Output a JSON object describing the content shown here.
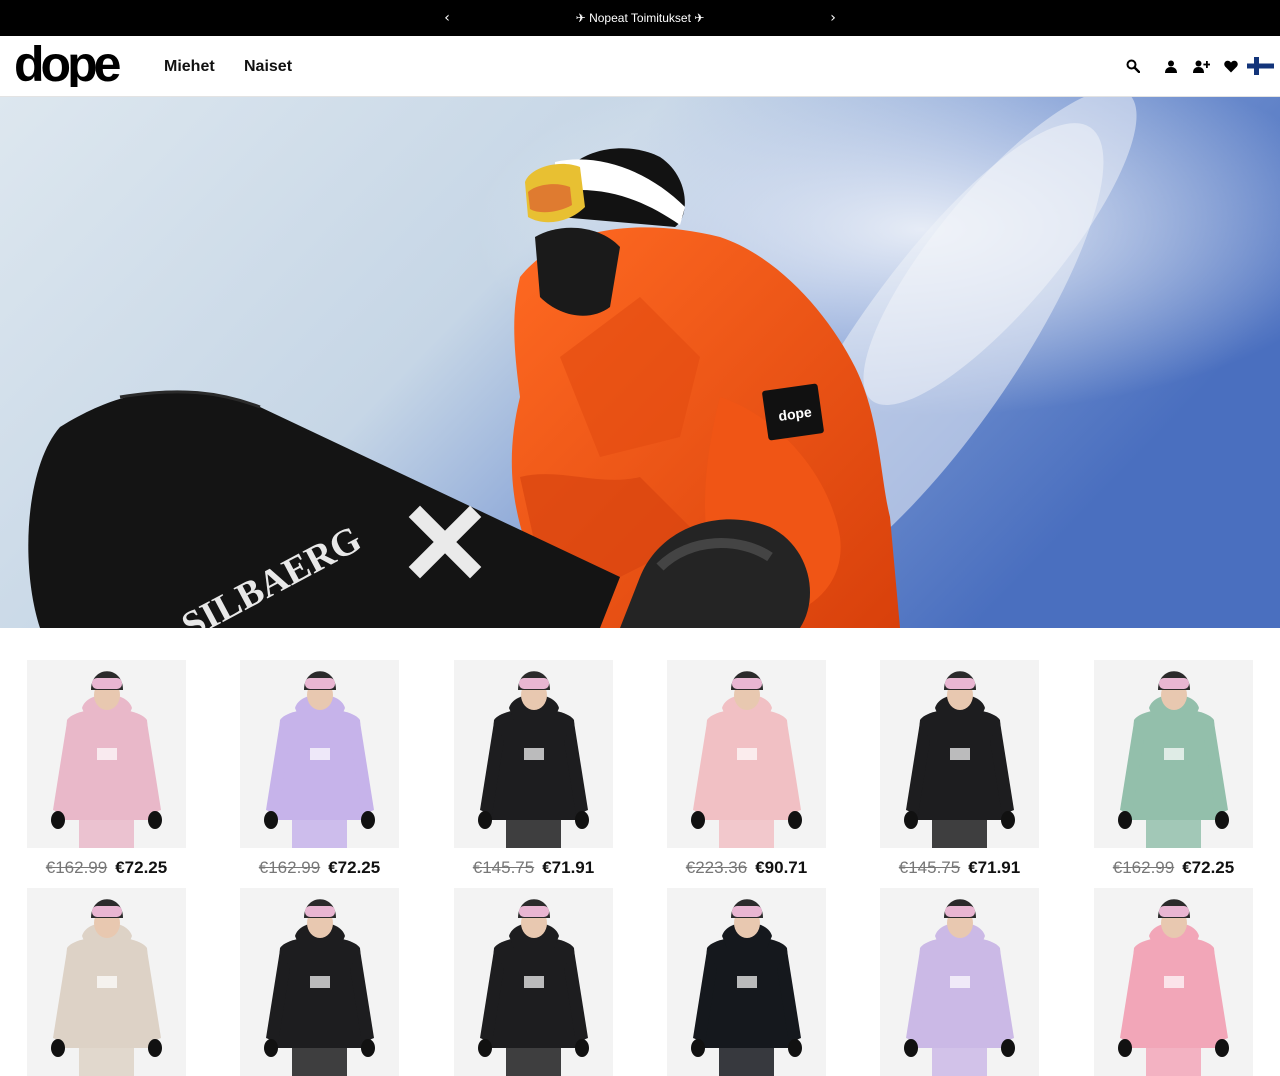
{
  "announcement": {
    "prev_label": "‹",
    "next_label": "›",
    "plane_icon": "✈",
    "text": "Nopeat Toimitukset"
  },
  "header": {
    "logo_text": "dope",
    "nav": [
      {
        "label": "Miehet"
      },
      {
        "label": "Naiset"
      }
    ],
    "icons": [
      "search-icon",
      "account-icon",
      "register-icon",
      "wishlist-icon"
    ],
    "flag": "finland-flag-icon"
  },
  "hero": {
    "icon": "hero-image-snowboarder-orange-jacket",
    "board_print": "SILBAERG"
  },
  "products": [
    {
      "old_price": "€162.99",
      "new_price": "€72.25",
      "color": "#e9b8c9"
    },
    {
      "old_price": "€162.99",
      "new_price": "€72.25",
      "color": "#c6b3ea"
    },
    {
      "old_price": "€145.75",
      "new_price": "€71.91",
      "color": "#1d1d1f"
    },
    {
      "old_price": "€223.36",
      "new_price": "€90.71",
      "color": "#f1c0c4"
    },
    {
      "old_price": "€145.75",
      "new_price": "€71.91",
      "color": "#1d1d1f"
    },
    {
      "old_price": "€162.99",
      "new_price": "€72.25",
      "color": "#93bfab"
    },
    {
      "color": "#ddd2c6"
    },
    {
      "color": "#1d1d1f"
    },
    {
      "color": "#1d1d1f"
    },
    {
      "color": "#15181d"
    },
    {
      "color": "#cbb9e6"
    },
    {
      "color": "#f2a6b8"
    }
  ],
  "colors": {
    "announcement_bg": "#000000",
    "hero_sky": "#6f8fce",
    "jacket_orange": "#f45a17"
  }
}
